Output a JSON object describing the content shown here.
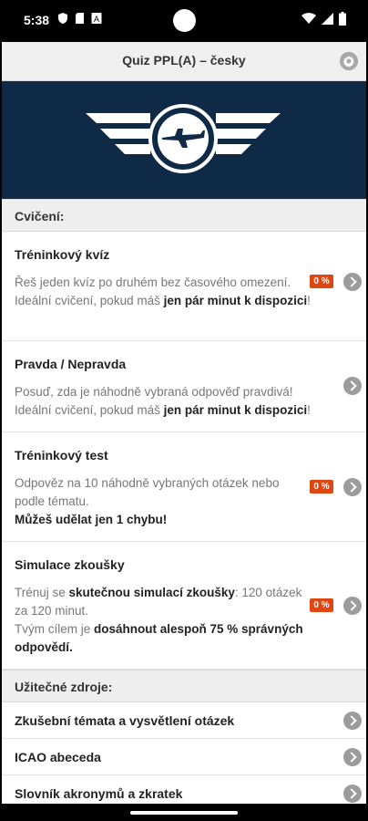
{
  "status": {
    "time": "5:38"
  },
  "header": {
    "title": "Quiz PPL(A) – česky"
  },
  "colors": {
    "banner_bg": "#0f2a47",
    "badge_bg": "#e04612",
    "arrow_bg": "#9c9c9c"
  },
  "section_practice": {
    "title": "Cvičení:"
  },
  "items": [
    {
      "title": "Tréninkový kvíz",
      "desc_plain_1": "Řeš jeden kvíz po druhém bez časového omezení. Ideální cvičení, pokud máš ",
      "desc_bold_1": "jen pár minut k dispozici",
      "desc_plain_2": "!",
      "badge": "0 %"
    },
    {
      "title": "Pravda / Nepravda",
      "desc_plain_1": "Posuď, zda je náhodně vybraná odpověď pravdivá! Ideální cvičení, pokud máš ",
      "desc_bold_1": "jen pár minut k dispozici",
      "desc_plain_2": "!"
    },
    {
      "title": "Tréninkový test",
      "desc_plain_1": "Odpověz na 10 náhodně vybraných otázek nebo podle tématu.",
      "desc_bold_1": "Můžeš udělat jen 1 chybu!",
      "badge": "0 %"
    },
    {
      "title": "Simulace zkoušky",
      "desc_plain_1": "Trénuj se ",
      "desc_bold_1": "skutečnou simulací zkoušky",
      "desc_plain_2": ": 120 otázek za 120 minut.",
      "desc_plain_3": "Tvým cílem je ",
      "desc_bold_2": "dosáhnout alespoň 75 % správných odpovědí.",
      "badge": "0 %"
    }
  ],
  "section_resources": {
    "title": "Užitečné zdroje:"
  },
  "resources": [
    "Zkušební témata a vysvětlení otázek",
    "ICAO abeceda",
    "Slovník akronymů a zkratek"
  ]
}
